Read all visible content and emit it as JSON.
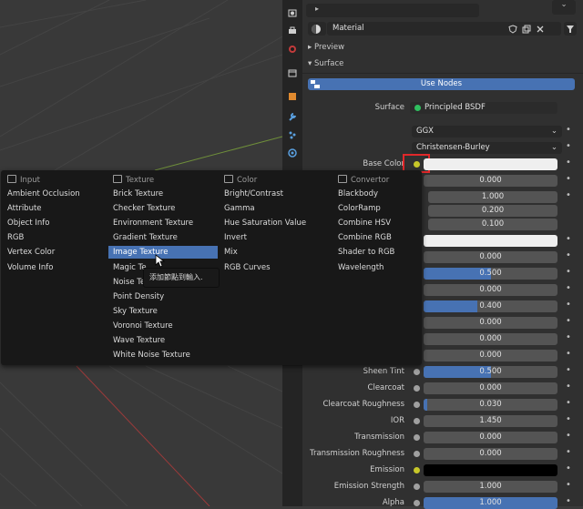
{
  "properties": {
    "material_name": "Material",
    "sections": {
      "preview": "Preview",
      "surface": "Surface"
    },
    "use_nodes": "Use Nodes",
    "surface_label": "Surface",
    "surface_shader": "Principled BSDF",
    "distribution": "GGX",
    "subsurface_method": "Christensen-Burley",
    "base_color_label": "Base Color",
    "values": {
      "base_color_next": "0.000",
      "radius_1": "1.000",
      "radius_2": "0.200",
      "radius_3": "0.100",
      "metallic_area_0": "0.000",
      "specular": "0.500",
      "specular_tint": "0.000",
      "roughness": "0.400",
      "anisotropic": "0.000",
      "anisotropic_rotation": "0.000",
      "sheen": "0.000"
    },
    "rows": [
      {
        "label": "Sheen Tint",
        "value": "0.500",
        "fill": 0.5
      },
      {
        "label": "Clearcoat",
        "value": "0.000",
        "fill": 0
      },
      {
        "label": "Clearcoat Roughness",
        "value": "0.030",
        "fill": 0.03
      },
      {
        "label": "IOR",
        "value": "1.450",
        "fill": 0
      },
      {
        "label": "Transmission",
        "value": "0.000",
        "fill": 0
      },
      {
        "label": "Transmission Roughness",
        "value": "0.000",
        "fill": 0
      },
      {
        "label": "Emission",
        "value": "",
        "fill": 0
      },
      {
        "label": "Emission Strength",
        "value": "1.000",
        "fill": 0
      },
      {
        "label": "Alpha",
        "value": "1.000",
        "fill": 1
      }
    ],
    "colors": {
      "accent": "#4772b3",
      "base_color_socket": "#c7c729",
      "shader_socket": "#2fbf5f",
      "highlight_box": "#e0282a"
    }
  },
  "menu": {
    "input": {
      "title": "Input",
      "items": [
        "Ambient Occlusion",
        "Attribute",
        "Object Info",
        "RGB",
        "Vertex Color",
        "Volume Info"
      ]
    },
    "texture": {
      "title": "Texture",
      "items": [
        "Brick Texture",
        "Checker Texture",
        "Environment Texture",
        "Gradient Texture",
        "Image Texture",
        "Magic Te",
        "Noise Te",
        "Point Density",
        "Sky Texture",
        "Voronoi Texture",
        "Wave Texture",
        "White Noise Texture"
      ]
    },
    "color": {
      "title": "Color",
      "items": [
        "Bright/Contrast",
        "Gamma",
        "Hue Saturation Value",
        "Invert",
        "Mix",
        "RGB Curves"
      ]
    },
    "convertor": {
      "title": "Convertor",
      "items": [
        "Blackbody",
        "ColorRamp",
        "Combine HSV",
        "Combine RGB",
        "Shader to RGB",
        "Wavelength"
      ]
    },
    "highlighted": "Image Texture",
    "tooltip": "添加節點到輸入."
  }
}
